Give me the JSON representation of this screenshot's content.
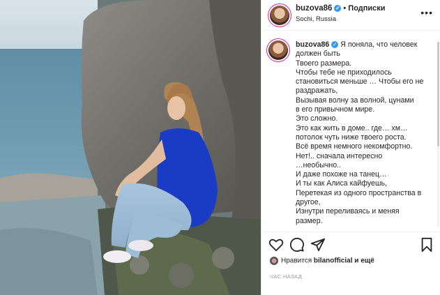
{
  "header": {
    "username": "buzova86",
    "separator": "•",
    "follow_label": "Подписки",
    "location": "Sochi, Russia",
    "more": "•••"
  },
  "caption": {
    "username": "buzova86",
    "lines": [
      "Я поняла, что человек",
      "должен быть",
      "Твоего размера.",
      "Чтобы тебе не приходилось",
      "становиться меньше … Чтобы его не",
      "раздражать,",
      "Вызывая волну за волной, цунами",
      "в его привычном мире.",
      "Это сложно.",
      "Это как жить в доме.. где… хм…",
      "потолок чуть ниже твоего роста.",
      "Всё время немного некомфортно.",
      "Нет!.. сначала интересно",
      "…необычно..",
      "И даже похоже на танец…",
      "И ты как Алиса кайфуешь,",
      "Перетекая из одного пространства в",
      "другое,",
      "Изнутри переливаясь и меняя",
      "размер."
    ]
  },
  "likes": {
    "prefix": "Нравится",
    "user": "bilanofficial",
    "suffix": "и ещё"
  },
  "timestamp": "ЧАС НАЗАД",
  "icons": [
    "heart-icon",
    "comment-icon",
    "share-icon",
    "bookmark-icon",
    "verified-icon",
    "more-icon"
  ]
}
